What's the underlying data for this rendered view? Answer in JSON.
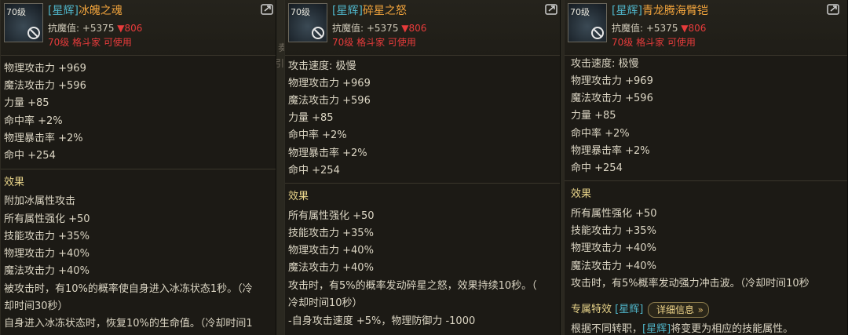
{
  "panels": [
    {
      "level": "70级",
      "rarity": "[星辉]",
      "name": "冰魄之魂",
      "resist_label": "抗魔值: +5375 ",
      "resist_change": "▼806",
      "requirement": "70级 格斗家 可使用",
      "stats": [
        "物理攻击力 +969",
        "魔法攻击力 +596",
        "力量 +85",
        "命中率 +2%",
        "物理暴击率 +2%",
        "命中 +254"
      ],
      "effects_title": "效果",
      "effects": [
        "附加冰属性攻击",
        "所有属性强化 +50",
        "技能攻击力 +35%",
        "物理攻击力 +40%",
        "魔法攻击力 +40%",
        "被攻击时，有10%的概率使自身进入冰冻状态1秒。（冷",
        "却时间30秒）",
        "自身进入冰冻状态时，恢复10%的生命值。（冷却时间1"
      ]
    },
    {
      "level": "70级",
      "rarity": "[星辉]",
      "name": "碎星之怒",
      "resist_label": "抗魔值: +5375 ",
      "resist_change": "▼806",
      "requirement": "70级 格斗家 可使用",
      "stats": [
        "攻击速度: 极慢",
        "物理攻击力 +969",
        "魔法攻击力 +596",
        "力量 +85",
        "命中率 +2%",
        "物理暴击率 +2%",
        "命中 +254"
      ],
      "effects_title": "效果",
      "effects": [
        "所有属性强化 +50",
        "技能攻击力 +35%",
        "物理攻击力 +40%",
        "魔法攻击力 +40%",
        "攻击时，有5%的概率发动碎星之怒，效果持续10秒。（",
        "冷却时间10秒）",
        "-自身攻击速度 +5%，物理防御力 -1000"
      ]
    },
    {
      "level": "70级",
      "rarity": "[星辉]",
      "name": "青龙腾海臂铠",
      "resist_label": "抗魔值: +5375 ",
      "resist_change": "▼806",
      "requirement": "70级 格斗家 可使用",
      "stats": [
        "攻击速度: 极慢",
        "物理攻击力 +969",
        "魔法攻击力 +596",
        "力量 +85",
        "命中率 +2%",
        "物理暴击率 +2%",
        "命中 +254"
      ],
      "effects_title": "效果",
      "effects": [
        "所有属性强化 +50",
        "技能攻击力 +35%",
        "物理攻击力 +40%",
        "魔法攻击力 +40%",
        "攻击时，有5%概率发动强力冲击波。（冷却时间10秒"
      ],
      "exclusive_label": "专属特效",
      "exclusive_rarity": "[星辉]",
      "detail_button": "详细信息",
      "exclusive_desc_a": "根据不同转职，",
      "exclusive_desc_rarity": "[星辉]",
      "exclusive_desc_b": "将变更为相应的技能属性。"
    }
  ],
  "faint_glyphs": [
    "奏",
    "引子"
  ],
  "colors": {
    "rarity": "#4fb4c8",
    "name": "#f0a33c",
    "warning": "#e63b3b",
    "section": "#e8d48a"
  },
  "icons": [
    "equipment-icon",
    "unusable-icon",
    "share-icon",
    "chevron-right-icon"
  ]
}
